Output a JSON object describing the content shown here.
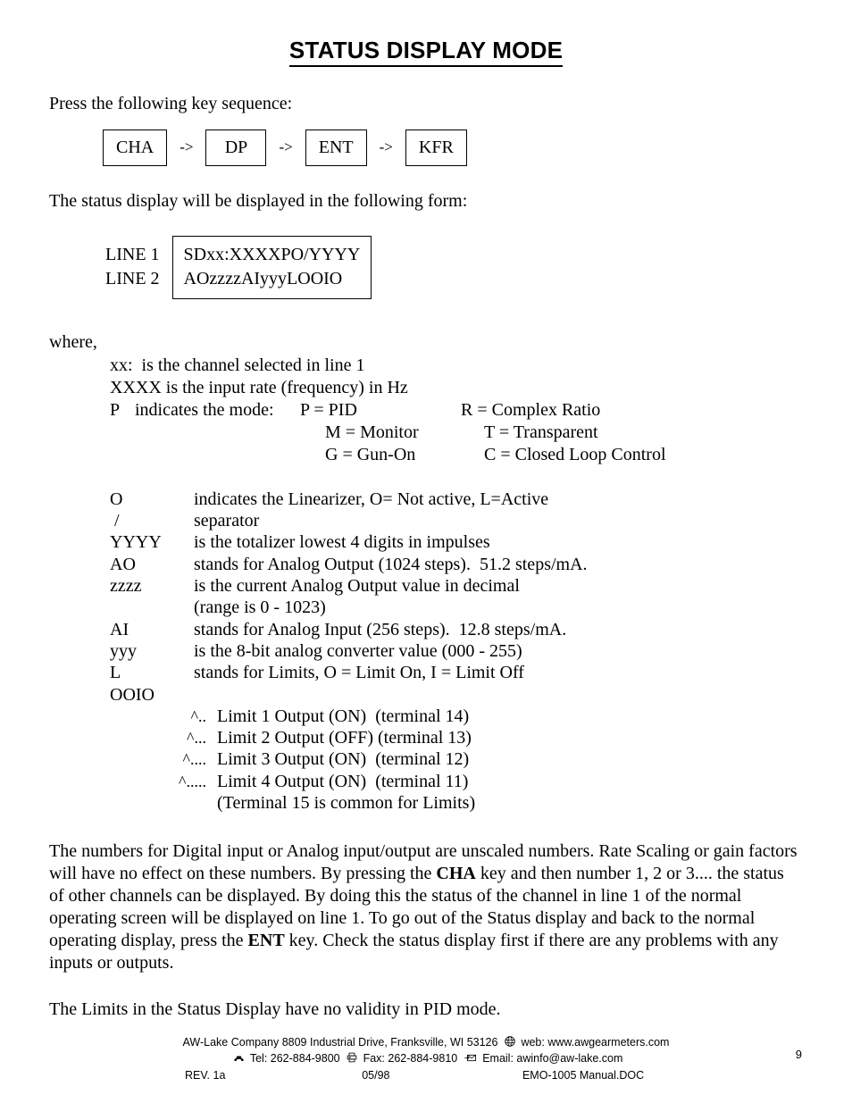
{
  "document": {
    "title": "STATUS DISPLAY MODE",
    "intro_press": "Press the following key sequence:",
    "intro_form": "The status display will be displayed in the following form:",
    "where_label": "where,"
  },
  "key_sequence": {
    "keys": [
      "CHA",
      "DP",
      "ENT",
      "KFR"
    ],
    "arrow": "->"
  },
  "display_form": {
    "line1_label": "LINE 1",
    "line2_label": "LINE 2",
    "line1_value": "SDxx:XXXXPO/YYYY",
    "line2_value": "AOzzzzAIyyyLOOIO"
  },
  "definitions_top": [
    "xx:  is the channel selected in line 1",
    "XXXX is the input rate (frequency) in Hz"
  ],
  "mode_table": {
    "symbol": "P",
    "label": "indicates the mode:",
    "rows": [
      {
        "left": "P = PID",
        "right": "R = Complex Ratio"
      },
      {
        "left": "M = Monitor",
        "right": "T = Transparent"
      },
      {
        "left": "G = Gun-On",
        "right": "C = Closed Loop Control"
      }
    ]
  },
  "definitions": [
    {
      "term": "O",
      "desc": "indicates the Linearizer, O= Not active, L=Active"
    },
    {
      "term": " /",
      "desc": "separator"
    },
    {
      "term": "YYYY",
      "desc": "is the totalizer lowest 4 digits in impulses"
    },
    {
      "term": "AO",
      "desc": "stands for Analog Output (1024 steps).  51.2 steps/mA."
    },
    {
      "term": "zzzz",
      "desc": "is the current Analog Output value in decimal"
    },
    {
      "term": "",
      "desc": "(range is 0 - 1023)"
    },
    {
      "term": "AI",
      "desc": "stands for Analog Input (256 steps).  12.8 steps/mA."
    },
    {
      "term": "yyy",
      "desc": "is the 8-bit analog converter value (000 - 255)"
    },
    {
      "term": "L",
      "desc": "stands for Limits, O = Limit On, I = Limit Off"
    }
  ],
  "limits": {
    "pattern": "OOIO",
    "rows": [
      {
        "caret": "^..",
        "desc": "Limit 1 Output (ON)  (terminal 14)"
      },
      {
        "caret": "^...",
        "desc": "Limit 2 Output (OFF) (terminal 13)"
      },
      {
        "caret": "^....",
        "desc": "Limit 3 Output (ON)  (terminal 12)"
      },
      {
        "caret": "^.....",
        "desc": "Limit 4 Output (ON)  (terminal 11)"
      },
      {
        "caret": "",
        "desc": "(Terminal 15 is common for Limits)"
      }
    ]
  },
  "closing": {
    "part1": "The numbers for Digital input or Analog input/output are unscaled numbers. Rate Scaling or gain factors will have no effect on these numbers. By pressing the ",
    "bold1": "CHA",
    "part2": " key and then number 1, 2 or 3.... the status of other channels can be displayed. By doing this the status of the channel in line 1 of the normal operating screen will be displayed on line 1. To go out of the Status display and back to the normal operating display, press the ",
    "bold2": "ENT",
    "part3": " key. Check the status display first if there are any  problems with any inputs or outputs.",
    "final": "The Limits in the Status Display have no validity in PID mode."
  },
  "footer": {
    "company": "AW-Lake Company 8809 Industrial Drive, Franksville, WI 53126",
    "web_label": "web: www.awgearmeters.com",
    "tel_label": "Tel:  262-884-9800",
    "fax_label": "Fax:  262-884-9810",
    "email_label": "Email: awinfo@aw-lake.com",
    "rev": "REV. 1a",
    "date": "05/98",
    "file": "EMO-1005 Manual.DOC",
    "page_number": "9",
    "icons": {
      "web": "globe-icon",
      "tel": "telephone-icon",
      "fax": "fax-icon",
      "email": "envelope-icon"
    }
  }
}
